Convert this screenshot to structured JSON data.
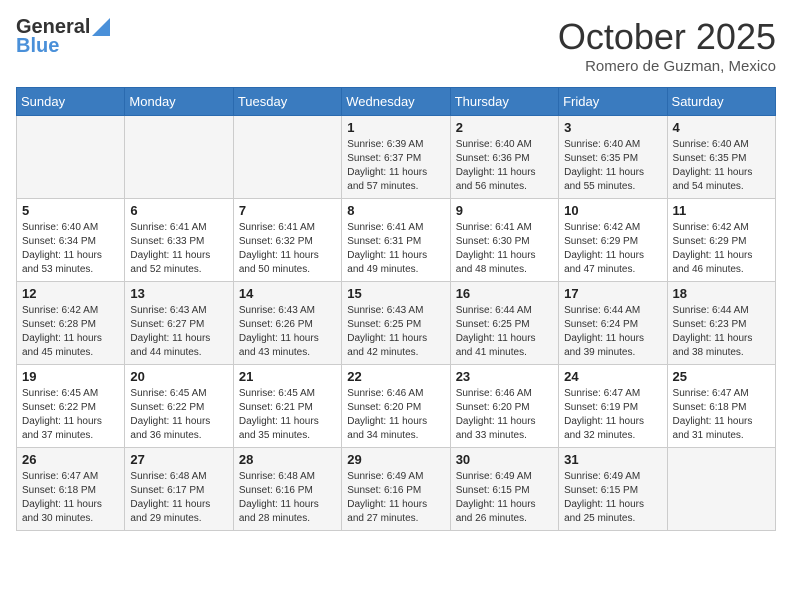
{
  "header": {
    "logo_line1": "General",
    "logo_line2": "Blue",
    "month": "October 2025",
    "location": "Romero de Guzman, Mexico"
  },
  "days_of_week": [
    "Sunday",
    "Monday",
    "Tuesday",
    "Wednesday",
    "Thursday",
    "Friday",
    "Saturday"
  ],
  "weeks": [
    [
      {
        "day": "",
        "info": ""
      },
      {
        "day": "",
        "info": ""
      },
      {
        "day": "",
        "info": ""
      },
      {
        "day": "1",
        "info": "Sunrise: 6:39 AM\nSunset: 6:37 PM\nDaylight: 11 hours\nand 57 minutes."
      },
      {
        "day": "2",
        "info": "Sunrise: 6:40 AM\nSunset: 6:36 PM\nDaylight: 11 hours\nand 56 minutes."
      },
      {
        "day": "3",
        "info": "Sunrise: 6:40 AM\nSunset: 6:35 PM\nDaylight: 11 hours\nand 55 minutes."
      },
      {
        "day": "4",
        "info": "Sunrise: 6:40 AM\nSunset: 6:35 PM\nDaylight: 11 hours\nand 54 minutes."
      }
    ],
    [
      {
        "day": "5",
        "info": "Sunrise: 6:40 AM\nSunset: 6:34 PM\nDaylight: 11 hours\nand 53 minutes."
      },
      {
        "day": "6",
        "info": "Sunrise: 6:41 AM\nSunset: 6:33 PM\nDaylight: 11 hours\nand 52 minutes."
      },
      {
        "day": "7",
        "info": "Sunrise: 6:41 AM\nSunset: 6:32 PM\nDaylight: 11 hours\nand 50 minutes."
      },
      {
        "day": "8",
        "info": "Sunrise: 6:41 AM\nSunset: 6:31 PM\nDaylight: 11 hours\nand 49 minutes."
      },
      {
        "day": "9",
        "info": "Sunrise: 6:41 AM\nSunset: 6:30 PM\nDaylight: 11 hours\nand 48 minutes."
      },
      {
        "day": "10",
        "info": "Sunrise: 6:42 AM\nSunset: 6:29 PM\nDaylight: 11 hours\nand 47 minutes."
      },
      {
        "day": "11",
        "info": "Sunrise: 6:42 AM\nSunset: 6:29 PM\nDaylight: 11 hours\nand 46 minutes."
      }
    ],
    [
      {
        "day": "12",
        "info": "Sunrise: 6:42 AM\nSunset: 6:28 PM\nDaylight: 11 hours\nand 45 minutes."
      },
      {
        "day": "13",
        "info": "Sunrise: 6:43 AM\nSunset: 6:27 PM\nDaylight: 11 hours\nand 44 minutes."
      },
      {
        "day": "14",
        "info": "Sunrise: 6:43 AM\nSunset: 6:26 PM\nDaylight: 11 hours\nand 43 minutes."
      },
      {
        "day": "15",
        "info": "Sunrise: 6:43 AM\nSunset: 6:25 PM\nDaylight: 11 hours\nand 42 minutes."
      },
      {
        "day": "16",
        "info": "Sunrise: 6:44 AM\nSunset: 6:25 PM\nDaylight: 11 hours\nand 41 minutes."
      },
      {
        "day": "17",
        "info": "Sunrise: 6:44 AM\nSunset: 6:24 PM\nDaylight: 11 hours\nand 39 minutes."
      },
      {
        "day": "18",
        "info": "Sunrise: 6:44 AM\nSunset: 6:23 PM\nDaylight: 11 hours\nand 38 minutes."
      }
    ],
    [
      {
        "day": "19",
        "info": "Sunrise: 6:45 AM\nSunset: 6:22 PM\nDaylight: 11 hours\nand 37 minutes."
      },
      {
        "day": "20",
        "info": "Sunrise: 6:45 AM\nSunset: 6:22 PM\nDaylight: 11 hours\nand 36 minutes."
      },
      {
        "day": "21",
        "info": "Sunrise: 6:45 AM\nSunset: 6:21 PM\nDaylight: 11 hours\nand 35 minutes."
      },
      {
        "day": "22",
        "info": "Sunrise: 6:46 AM\nSunset: 6:20 PM\nDaylight: 11 hours\nand 34 minutes."
      },
      {
        "day": "23",
        "info": "Sunrise: 6:46 AM\nSunset: 6:20 PM\nDaylight: 11 hours\nand 33 minutes."
      },
      {
        "day": "24",
        "info": "Sunrise: 6:47 AM\nSunset: 6:19 PM\nDaylight: 11 hours\nand 32 minutes."
      },
      {
        "day": "25",
        "info": "Sunrise: 6:47 AM\nSunset: 6:18 PM\nDaylight: 11 hours\nand 31 minutes."
      }
    ],
    [
      {
        "day": "26",
        "info": "Sunrise: 6:47 AM\nSunset: 6:18 PM\nDaylight: 11 hours\nand 30 minutes."
      },
      {
        "day": "27",
        "info": "Sunrise: 6:48 AM\nSunset: 6:17 PM\nDaylight: 11 hours\nand 29 minutes."
      },
      {
        "day": "28",
        "info": "Sunrise: 6:48 AM\nSunset: 6:16 PM\nDaylight: 11 hours\nand 28 minutes."
      },
      {
        "day": "29",
        "info": "Sunrise: 6:49 AM\nSunset: 6:16 PM\nDaylight: 11 hours\nand 27 minutes."
      },
      {
        "day": "30",
        "info": "Sunrise: 6:49 AM\nSunset: 6:15 PM\nDaylight: 11 hours\nand 26 minutes."
      },
      {
        "day": "31",
        "info": "Sunrise: 6:49 AM\nSunset: 6:15 PM\nDaylight: 11 hours\nand 25 minutes."
      },
      {
        "day": "",
        "info": ""
      }
    ]
  ]
}
